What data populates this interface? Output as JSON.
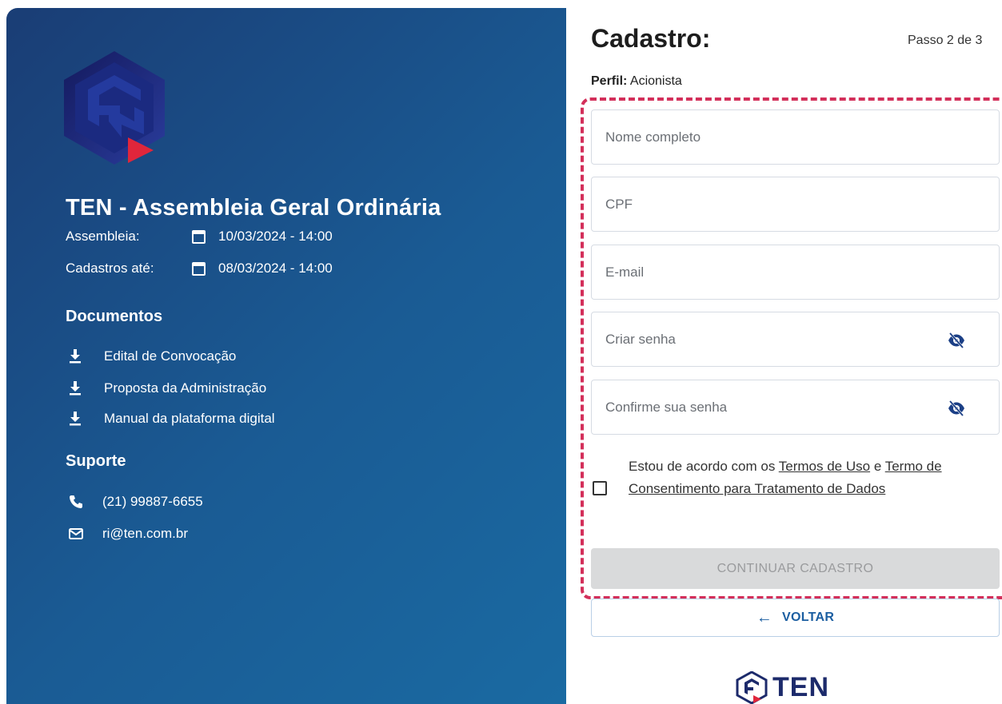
{
  "event": {
    "title": "TEN - Assembleia Geral Ordinária",
    "assembleia_label": "Assembleia:",
    "assembleia_date": "10/03/2024 - 14:00",
    "cadastros_label": "Cadastros até:",
    "cadastros_date": "08/03/2024 - 14:00"
  },
  "documents": {
    "title": "Documentos",
    "items": [
      {
        "label": "Edital de Convocação"
      },
      {
        "label": "Proposta da Administração"
      },
      {
        "label": "Manual da plataforma digital"
      }
    ]
  },
  "support": {
    "title": "Suporte",
    "phone": "(21) 99887-6655",
    "email": "ri@ten.com.br"
  },
  "form": {
    "title": "Cadastro:",
    "step": "Passo 2 de 3",
    "profile_label": "Perfil:",
    "profile_value": "Acionista",
    "fields": {
      "name_placeholder": "Nome completo",
      "cpf_placeholder": "CPF",
      "email_placeholder": "E-mail",
      "password_placeholder": "Criar senha",
      "confirm_placeholder": "Confirme sua senha"
    },
    "consent": {
      "prefix": "Estou de acordo com os",
      "terms_link": "Termos de Uso",
      "conj": "e",
      "consent_link": "Termo de Consentimento para Tratamento de Dados",
      "checked": false
    },
    "continue_label": "CONTINUAR CADASTRO",
    "back_label": "VOLTAR"
  },
  "footer": {
    "brand": "TEN"
  },
  "colors": {
    "panel_start": "#1a3d75",
    "panel_end": "#1a6aa2",
    "highlight": "#d32f5a",
    "link_blue": "#1b5ea1",
    "logo_red": "#e0263b"
  },
  "icons": [
    "calendar-icon",
    "download-icon",
    "phone-icon",
    "mail-icon",
    "eye-off-icon",
    "arrow-left-icon"
  ]
}
